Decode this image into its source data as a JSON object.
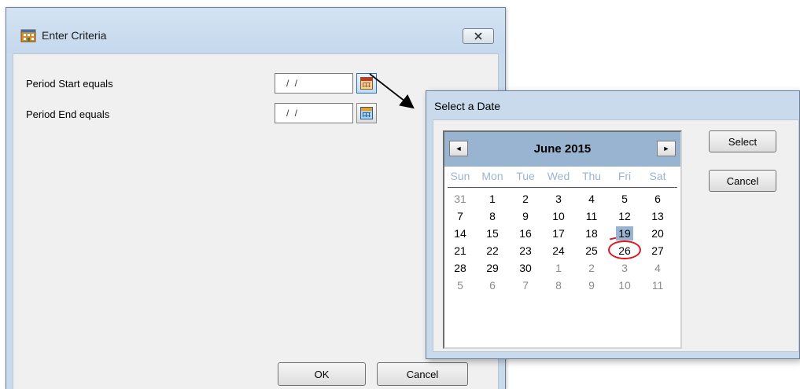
{
  "criteria_dialog": {
    "title": "Enter Criteria",
    "fields": [
      {
        "label": "Period Start equals",
        "value": "/ /"
      },
      {
        "label": "Period End equals",
        "value": "/ /"
      }
    ],
    "ok_label": "OK",
    "cancel_label": "Cancel"
  },
  "date_dialog": {
    "title": "Select a Date",
    "month_year": "June 2015",
    "prev_glyph": "◄",
    "next_glyph": "►",
    "weekdays": [
      "Sun",
      "Mon",
      "Tue",
      "Wed",
      "Thu",
      "Fri",
      "Sat"
    ],
    "weeks": [
      [
        "31",
        "1",
        "2",
        "3",
        "4",
        "5",
        "6"
      ],
      [
        "7",
        "8",
        "9",
        "10",
        "11",
        "12",
        "13"
      ],
      [
        "14",
        "15",
        "16",
        "17",
        "18",
        "19",
        "20"
      ],
      [
        "21",
        "22",
        "23",
        "24",
        "25",
        "26",
        "27"
      ],
      [
        "28",
        "29",
        "30",
        "1",
        "2",
        "3",
        "4"
      ],
      [
        "5",
        "6",
        "7",
        "8",
        "9",
        "10",
        "11"
      ]
    ],
    "selected_day": "19",
    "select_label": "Select",
    "cancel_label": "Cancel"
  },
  "icons": {
    "app_icon": "building-icon",
    "calendar_button": "calendar-icon",
    "close": "close-icon"
  },
  "colors": {
    "title_bar": "#c8daec",
    "calendar_header": "#99b4d1",
    "annotation": "#e0161f"
  }
}
